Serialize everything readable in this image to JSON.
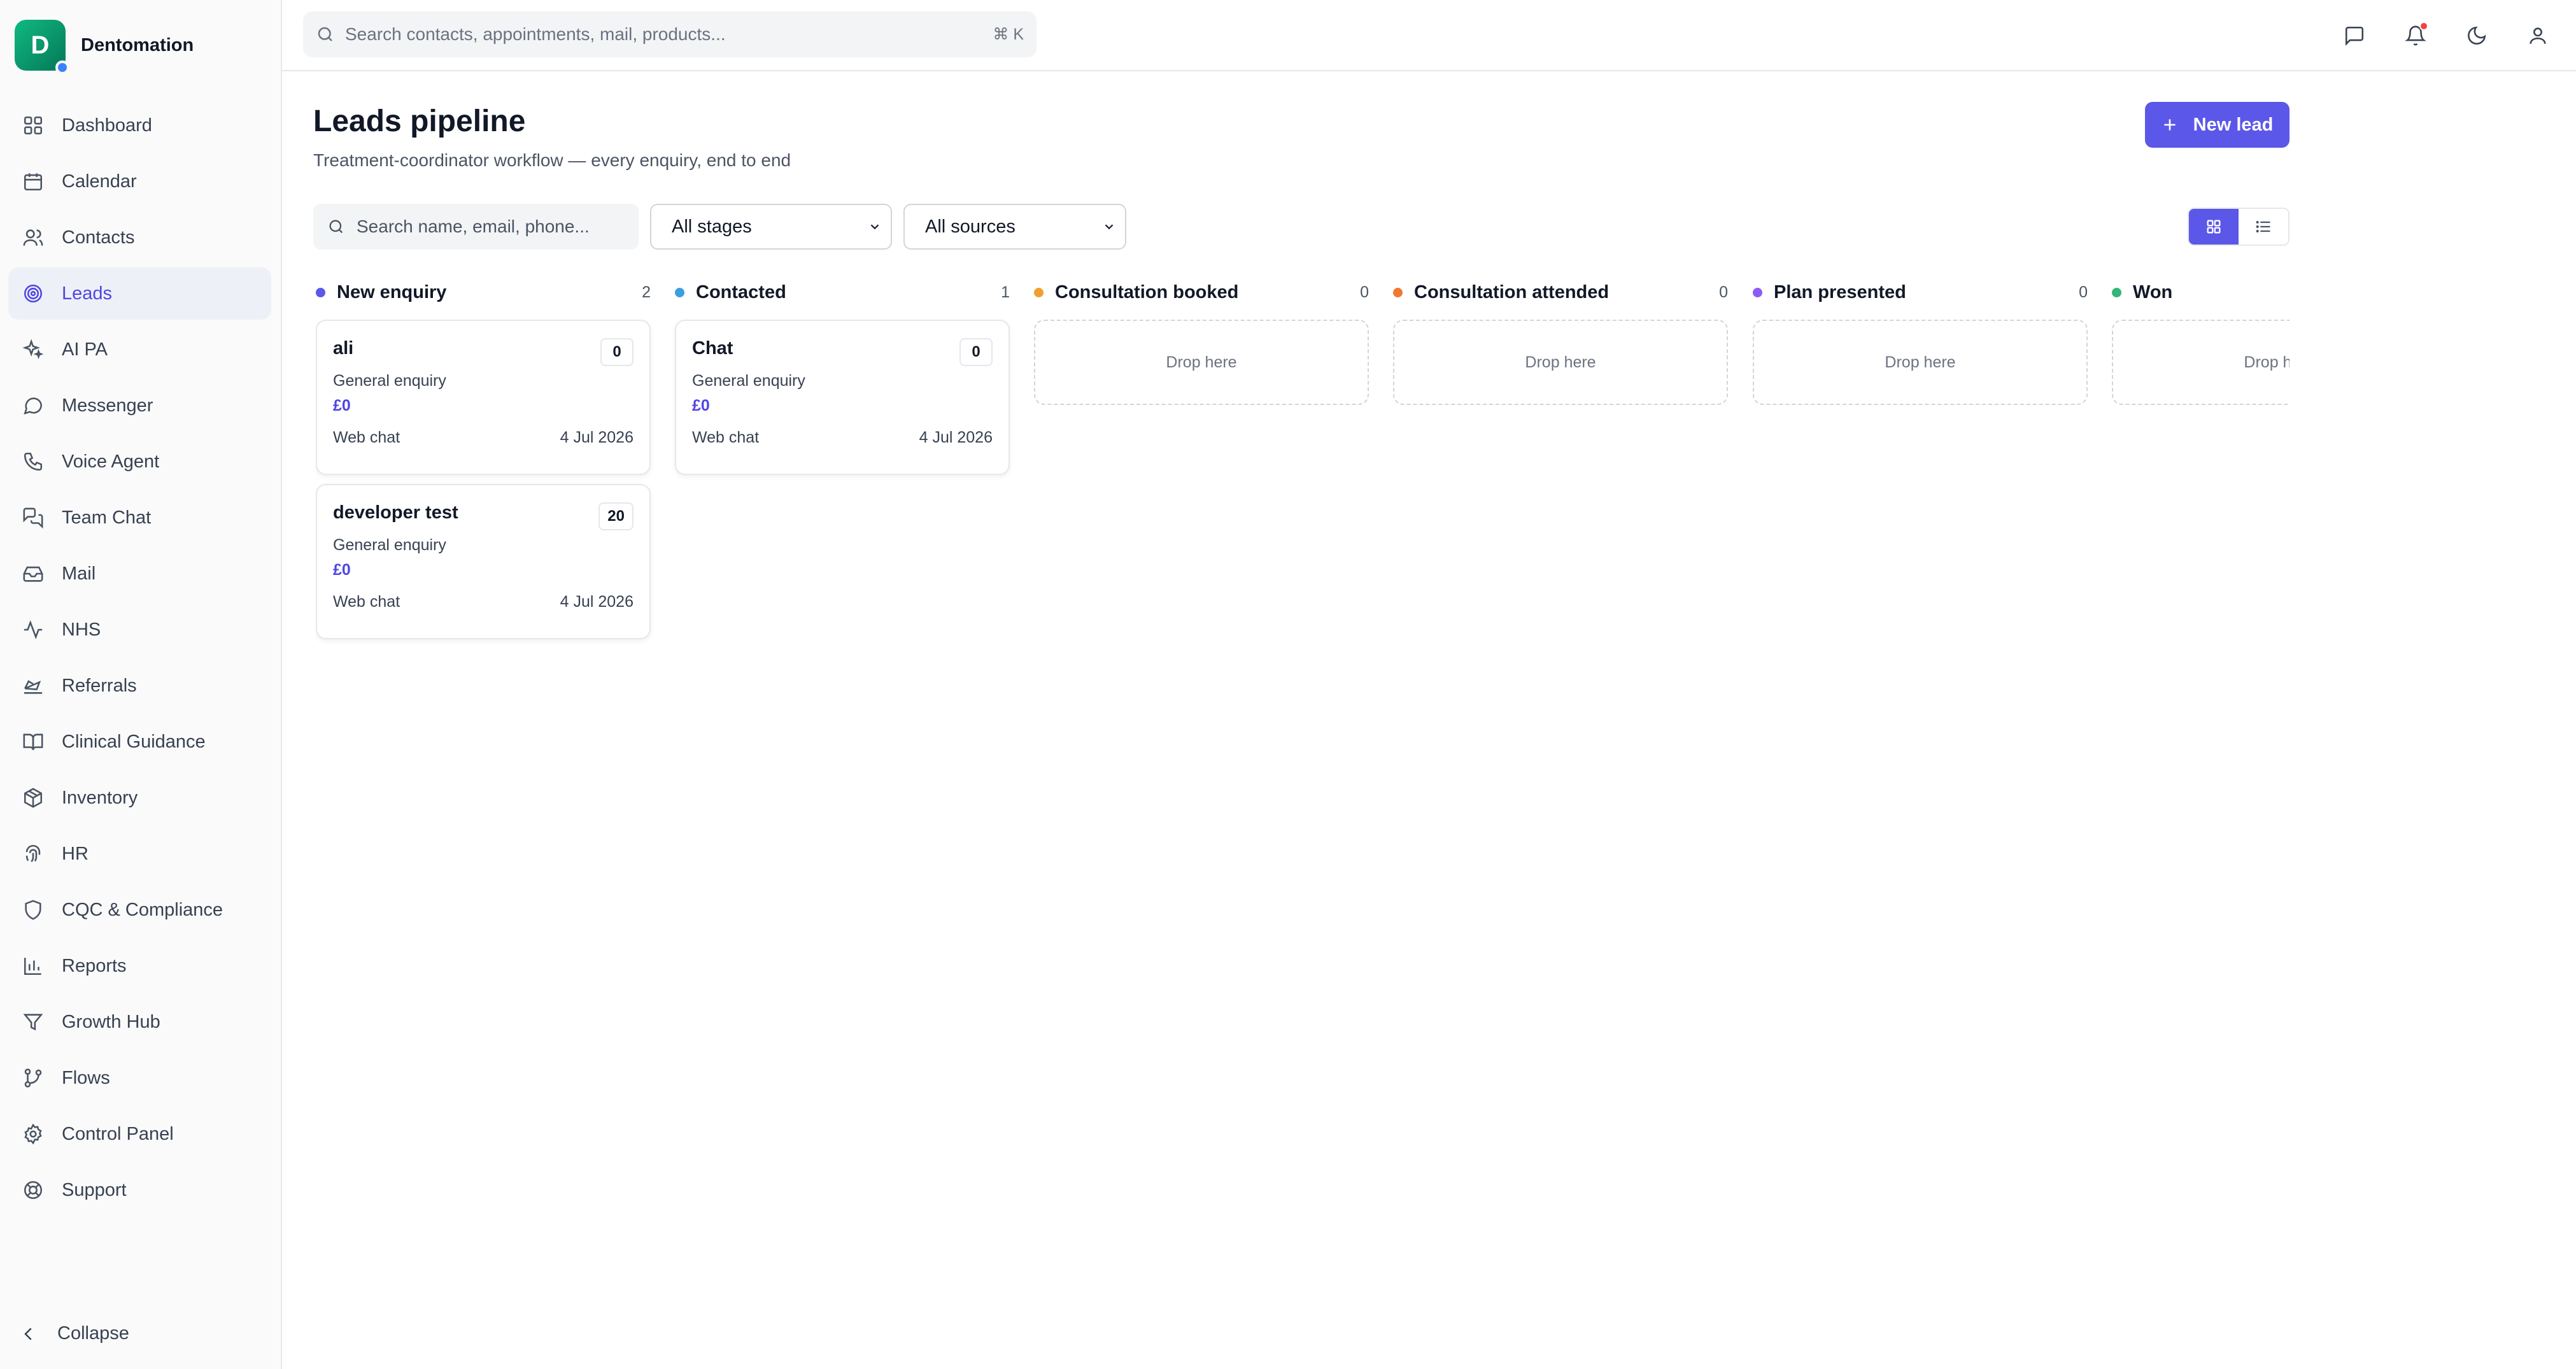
{
  "brand": {
    "initial": "D",
    "name": "Dentomation"
  },
  "sidebar": {
    "items": [
      {
        "label": "Dashboard"
      },
      {
        "label": "Calendar"
      },
      {
        "label": "Contacts"
      },
      {
        "label": "Leads"
      },
      {
        "label": "AI PA"
      },
      {
        "label": "Messenger"
      },
      {
        "label": "Voice Agent"
      },
      {
        "label": "Team Chat"
      },
      {
        "label": "Mail"
      },
      {
        "label": "NHS"
      },
      {
        "label": "Referrals"
      },
      {
        "label": "Clinical Guidance"
      },
      {
        "label": "Inventory"
      },
      {
        "label": "HR"
      },
      {
        "label": "CQC & Compliance"
      },
      {
        "label": "Reports"
      },
      {
        "label": "Growth Hub"
      },
      {
        "label": "Flows"
      },
      {
        "label": "Control Panel"
      },
      {
        "label": "Support"
      }
    ],
    "collapse_label": "Collapse"
  },
  "topbar": {
    "search_placeholder": "Search contacts, appointments, mail, products...",
    "shortcut": "⌘ K"
  },
  "page": {
    "title": "Leads pipeline",
    "subtitle": "Treatment-coordinator workflow — every enquiry, end to end",
    "new_lead_label": "New lead"
  },
  "filters": {
    "search_placeholder": "Search name, email, phone...",
    "stage_selected": "All stages",
    "source_selected": "All sources"
  },
  "colors": {
    "accent": "#5b57e8",
    "new_enquiry": "#5b57e8",
    "contacted": "#3b9fe0",
    "consultation_booked": "#f0a030",
    "consultation_attended": "#f07830",
    "plan_presented": "#8b5cf6",
    "won": "#34b57a"
  },
  "board": {
    "drop_label": "Drop here",
    "columns": [
      {
        "title": "New enquiry",
        "count": "2",
        "cards": [
          {
            "name": "ali",
            "score": "0",
            "type": "General enquiry",
            "value": "£0",
            "source": "Web chat",
            "date": "4 Jul 2026"
          },
          {
            "name": "developer test",
            "score": "20",
            "type": "General enquiry",
            "value": "£0",
            "source": "Web chat",
            "date": "4 Jul 2026"
          }
        ]
      },
      {
        "title": "Contacted",
        "count": "1",
        "cards": [
          {
            "name": "Chat",
            "score": "0",
            "type": "General enquiry",
            "value": "£0",
            "source": "Web chat",
            "date": "4 Jul 2026"
          }
        ]
      },
      {
        "title": "Consultation booked",
        "count": "0",
        "cards": []
      },
      {
        "title": "Consultation attended",
        "count": "0",
        "cards": []
      },
      {
        "title": "Plan presented",
        "count": "0",
        "cards": []
      },
      {
        "title": "Won",
        "count": "",
        "cards": []
      }
    ]
  }
}
